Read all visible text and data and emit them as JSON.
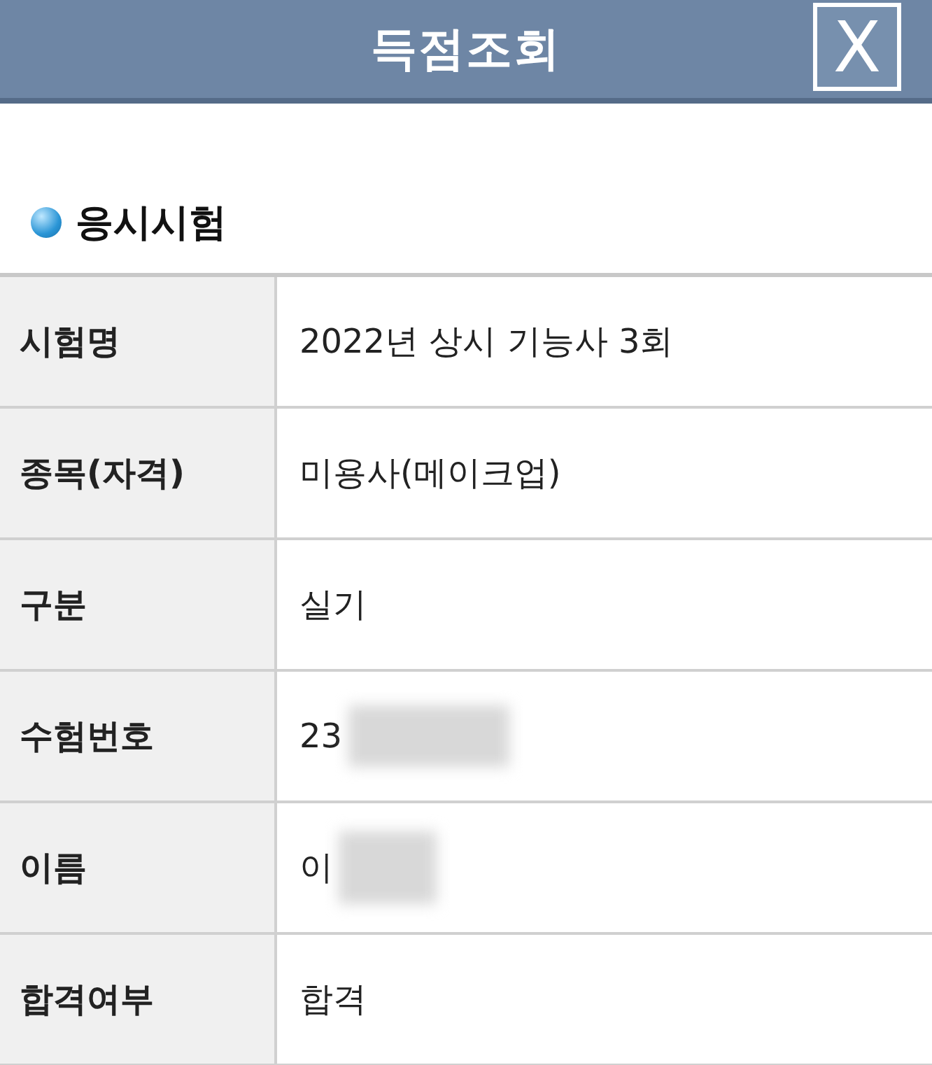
{
  "header": {
    "title": "득점조회",
    "close_label": "X"
  },
  "section": {
    "title": "응시시험"
  },
  "rows": [
    {
      "label": "시험명",
      "value": "2022년 상시 기능사 3회",
      "redacted": false
    },
    {
      "label": "종목(자격)",
      "value": "미용사(메이크업)",
      "redacted": false
    },
    {
      "label": "구분",
      "value": "실기",
      "redacted": false
    },
    {
      "label": "수험번호",
      "value": "23",
      "redacted": true
    },
    {
      "label": "이름",
      "value": "이",
      "redacted": true
    },
    {
      "label": "합격여부",
      "value": "합격",
      "redacted": false
    }
  ]
}
